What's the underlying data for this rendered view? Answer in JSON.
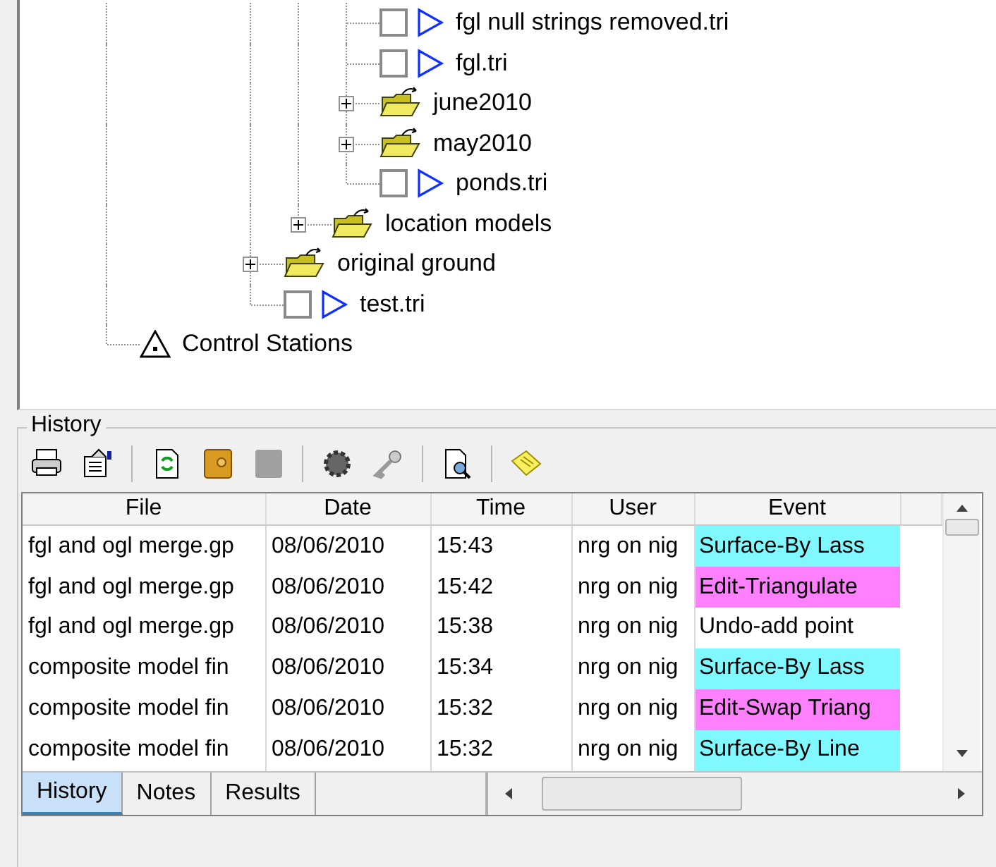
{
  "tree": [
    {
      "children": [
        {
          "children": [
            {
              "children": [
                {
                  "children": [
                    {
                      "children": [
                        {
                          "kind": "surface",
                          "label": "fgl null strings removed.tri",
                          "checked": false
                        },
                        {
                          "kind": "surface",
                          "label": "fgl.tri",
                          "checked": false
                        },
                        {
                          "kind": "folder",
                          "label": "june2010",
                          "expanded": false
                        },
                        {
                          "kind": "folder",
                          "label": "may2010",
                          "expanded": false
                        },
                        {
                          "kind": "surface",
                          "label": "ponds.tri",
                          "checked": false
                        }
                      ]
                    },
                    {
                      "kind": "folder",
                      "label": "location models",
                      "expanded": false
                    }
                  ]
                },
                {
                  "kind": "folder",
                  "label": "original ground",
                  "expanded": false
                },
                {
                  "kind": "surface",
                  "label": "test.tri",
                  "checked": false
                }
              ]
            }
          ]
        }
      ]
    },
    {
      "kind": "stations",
      "label": "Control Stations"
    }
  ],
  "history": {
    "title": "History",
    "columns": [
      "File",
      "Date",
      "Time",
      "User",
      "Event"
    ],
    "rows": [
      {
        "cells": [
          "fgl and ogl merge.gp",
          "08/06/2010",
          "15:43",
          "nrg on nig"
        ],
        "event": "Surface-By Lass",
        "color": "#80f8ff"
      },
      {
        "cells": [
          "fgl and ogl merge.gp",
          "08/06/2010",
          "15:42",
          "nrg on nig"
        ],
        "event": "Edit-Triangulate",
        "color": "#ff80ff"
      },
      {
        "cells": [
          "fgl and ogl merge.gp",
          "08/06/2010",
          "15:38",
          "nrg on nig"
        ],
        "event": "Undo-add point",
        "color": "#ffffff"
      },
      {
        "cells": [
          "composite model fin",
          "08/06/2010",
          "15:34",
          "nrg on nig"
        ],
        "event": "Surface-By Lass",
        "color": "#80f8ff"
      },
      {
        "cells": [
          "composite model fin",
          "08/06/2010",
          "15:32",
          "nrg on nig"
        ],
        "event": "Edit-Swap Triang",
        "color": "#ff80ff"
      },
      {
        "cells": [
          "composite model fin",
          "08/06/2010",
          "15:32",
          "nrg on nig"
        ],
        "event": "Surface-By Line",
        "color": "#80f8ff"
      }
    ],
    "tabs": [
      {
        "label": "History",
        "selected": true
      },
      {
        "label": "Notes",
        "selected": false
      },
      {
        "label": "Results",
        "selected": false
      }
    ]
  }
}
